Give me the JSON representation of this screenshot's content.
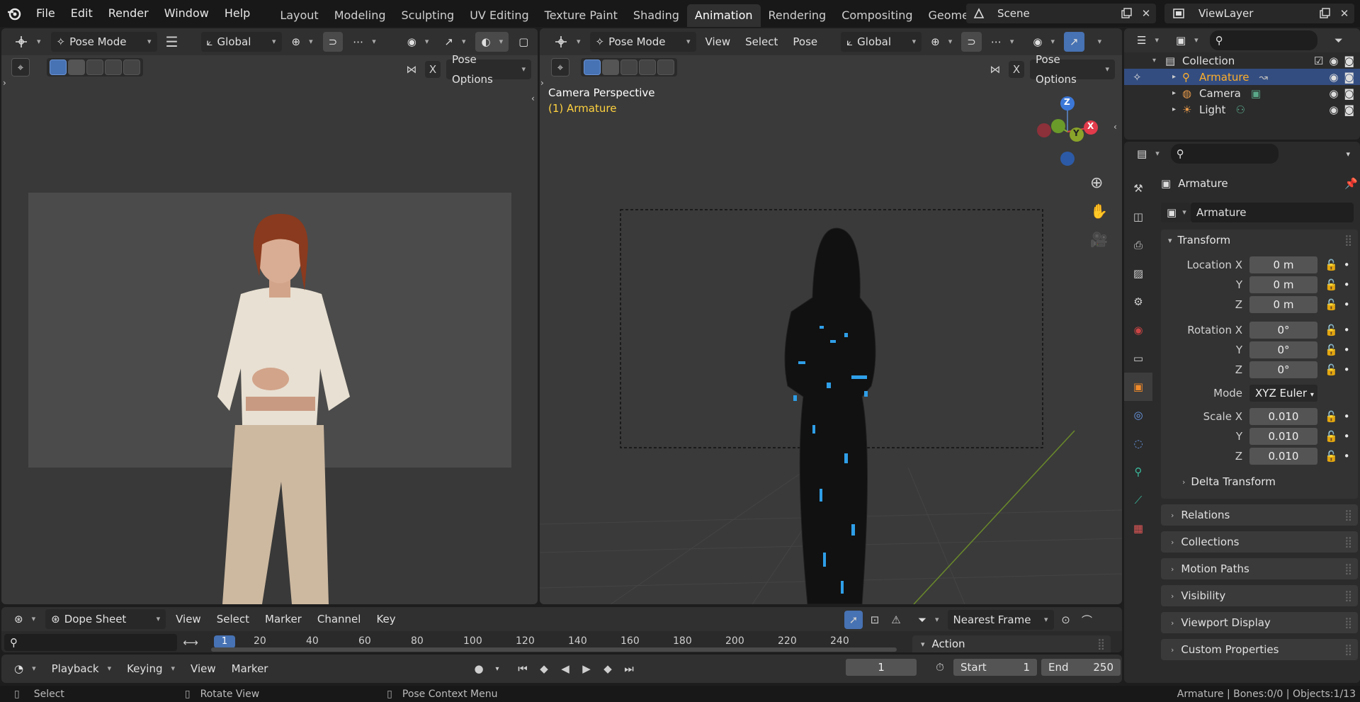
{
  "topbar": {
    "menus": [
      "File",
      "Edit",
      "Render",
      "Window",
      "Help"
    ],
    "workspaces": [
      "Layout",
      "Modeling",
      "Sculpting",
      "UV Editing",
      "Texture Paint",
      "Shading",
      "Animation",
      "Rendering",
      "Compositing",
      "Geometry Node"
    ],
    "active_workspace": "Animation",
    "scene": "Scene",
    "view_layer": "ViewLayer"
  },
  "left_viewport": {
    "mode": "Pose Mode",
    "orientation": "Global",
    "pose_options": "Pose Options",
    "x_label": "X"
  },
  "right_viewport": {
    "mode": "Pose Mode",
    "menus": [
      "View",
      "Select",
      "Pose"
    ],
    "orientation": "Global",
    "pose_options": "Pose Options",
    "x_label": "X",
    "overlay_title": "Camera Perspective",
    "overlay_object": "(1) Armature",
    "gizmo": {
      "z": "Z",
      "x": "X",
      "y": "Y"
    }
  },
  "outliner": {
    "collection": "Collection",
    "items": [
      {
        "name": "Armature",
        "selected": true
      },
      {
        "name": "Camera",
        "selected": false
      },
      {
        "name": "Light",
        "selected": false
      }
    ]
  },
  "properties": {
    "object_name": "Armature",
    "data_name": "Armature",
    "transform_title": "Transform",
    "location": {
      "label": "Location X",
      "x": "0 m",
      "y": "0 m",
      "z": "0 m"
    },
    "rotation": {
      "label": "Rotation X",
      "x": "0°",
      "y": "0°",
      "z": "0°"
    },
    "mode_label": "Mode",
    "mode_value": "XYZ Euler",
    "scale": {
      "label": "Scale X",
      "x": "0.010",
      "y": "0.010",
      "z": "0.010"
    },
    "axis_y": "Y",
    "axis_z": "Z",
    "delta": "Delta Transform",
    "sections": [
      "Relations",
      "Collections",
      "Motion Paths",
      "Visibility",
      "Viewport Display",
      "Custom Properties"
    ]
  },
  "dopesheet": {
    "editor": "Dope Sheet",
    "menus": [
      "View",
      "Select",
      "Marker",
      "Channel",
      "Key"
    ],
    "snap": "Nearest Frame",
    "action": "Action",
    "current_frame_marker": "1",
    "ticks": [
      "20",
      "40",
      "60",
      "80",
      "100",
      "120",
      "140",
      "160",
      "180",
      "200",
      "220",
      "240"
    ]
  },
  "timeline": {
    "menus": [
      "Playback",
      "Keying",
      "View",
      "Marker"
    ],
    "current_frame": "1",
    "start_label": "Start",
    "start": "1",
    "end_label": "End",
    "end": "250"
  },
  "statusbar": {
    "select": "Select",
    "rotate": "Rotate View",
    "context": "Pose Context Menu",
    "info": "Armature | Bones:0/0 | Objects:1/13"
  },
  "colors": {
    "accent": "#4772b3",
    "selection_text": "#ffaf29",
    "overlay_yellow": "#ffd23f"
  }
}
